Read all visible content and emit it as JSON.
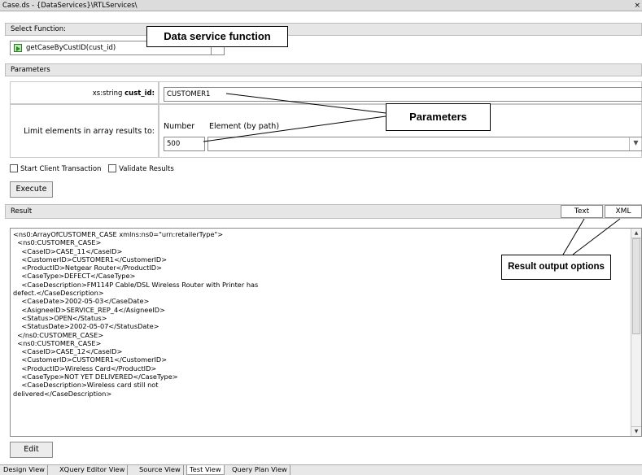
{
  "window": {
    "title": "Case.ds - {DataServices}\\RTLServices\\"
  },
  "select_function": {
    "header": "Select Function:",
    "value": "getCaseByCustID(cust_id)"
  },
  "parameters": {
    "header": "Parameters",
    "cust_id_type": "xs:string",
    "cust_id_name": "cust_id:",
    "cust_id_value": "CUSTOMER1",
    "limit_label": "Limit elements in array results to:",
    "number_label": "Number",
    "element_label": "Element (by path)",
    "number_value": "500",
    "element_value": ""
  },
  "options": {
    "start_client_transaction": "Start Client Transaction",
    "validate_results": "Validate Results"
  },
  "execute_label": "Execute",
  "result": {
    "header": "Result",
    "text_tab": "Text",
    "xml_tab": "XML",
    "content": "<ns0:ArrayOfCUSTOMER_CASE xmlns:ns0=\"urn:retailerType\">\n  <ns0:CUSTOMER_CASE>\n    <CaseID>CASE_11</CaseID>\n    <CustomerID>CUSTOMER1</CustomerID>\n    <ProductID>Netgear Router</ProductID>\n    <CaseType>DEFECT</CaseType>\n    <CaseDescription>FM114P Cable/DSL Wireless Router with Printer has\ndefect.</CaseDescription>\n    <CaseDate>2002-05-03</CaseDate>\n    <AsigneeID>SERVICE_REP_4</AsigneeID>\n    <Status>OPEN</Status>\n    <StatusDate>2002-05-07</StatusDate>\n  </ns0:CUSTOMER_CASE>\n  <ns0:CUSTOMER_CASE>\n    <CaseID>CASE_12</CaseID>\n    <CustomerID>CUSTOMER1</CustomerID>\n    <ProductID>Wireless Card</ProductID>\n    <CaseType>NOT YET DELIVERED</CaseType>\n    <CaseDescription>Wireless card still not\ndelivered</CaseDescription>"
  },
  "edit_label": "Edit",
  "callouts": {
    "data_service": "Data service function",
    "parameters": "Parameters",
    "result_output": "Result output options"
  },
  "bottom_tabs": [
    "Design View",
    "XQuery Editor View",
    "Source View",
    "Test View",
    "Query Plan View"
  ],
  "active_tab": "Test View"
}
